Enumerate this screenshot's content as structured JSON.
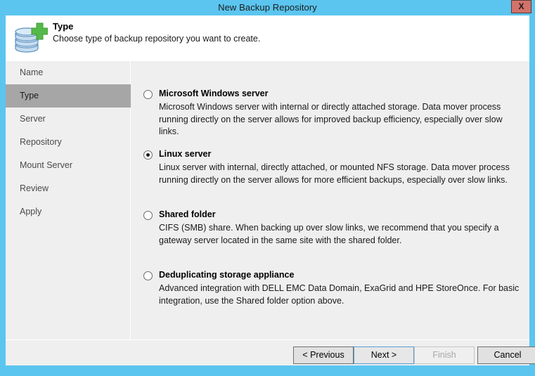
{
  "window": {
    "title": "New Backup Repository",
    "close_label": "X",
    "accent_color": "#5bc5ef",
    "close_color": "#d2726a"
  },
  "header": {
    "title": "Type",
    "subtitle": "Choose type of backup repository you want to create.",
    "icon": "database-add-icon"
  },
  "sidebar": {
    "items": [
      {
        "label": "Name",
        "active": false
      },
      {
        "label": "Type",
        "active": true
      },
      {
        "label": "Server",
        "active": false
      },
      {
        "label": "Repository",
        "active": false
      },
      {
        "label": "Mount Server",
        "active": false
      },
      {
        "label": "Review",
        "active": false
      },
      {
        "label": "Apply",
        "active": false
      }
    ],
    "active_background": "#a6a6a6"
  },
  "main": {
    "options": [
      {
        "label": "Microsoft Windows server",
        "description": "Microsoft Windows server with internal or directly attached storage. Data mover process running directly on the server allows for improved backup efficiency, especially over slow links.",
        "selected": false
      },
      {
        "label": "Linux server",
        "description": "Linux server with internal, directly attached, or mounted NFS storage. Data mover process running directly on the server allows for more efficient backups, especially over slow links.",
        "selected": true
      },
      {
        "label": "Shared folder",
        "description": "CIFS (SMB) share. When backing up over slow links, we recommend that you specify a gateway server located in the same site with the shared folder.",
        "selected": false
      },
      {
        "label": "Deduplicating storage appliance",
        "description": "Advanced integration with DELL EMC Data Domain, ExaGrid and HPE StoreOnce. For basic integration, use the Shared folder option above.",
        "selected": false
      }
    ]
  },
  "footer": {
    "previous_label": "< Previous",
    "next_label": "Next >",
    "finish_label": "Finish",
    "cancel_label": "Cancel",
    "next_focused": true,
    "finish_disabled": true
  }
}
